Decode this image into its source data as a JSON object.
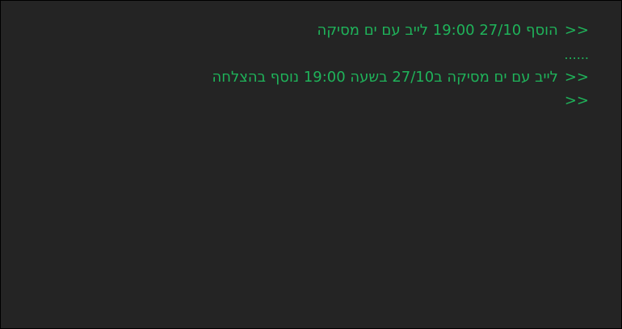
{
  "terminal": {
    "prompt": ">>",
    "lines": [
      {
        "type": "input",
        "text": "הוסף 27/10 19:00 לייב עם ים מסיקה"
      },
      {
        "type": "output",
        "text": "......"
      },
      {
        "type": "output_prompted",
        "text": "לייב עם ים מסיקה ב27/10 בשעה 19:00 נוסף בהצלחה"
      },
      {
        "type": "input",
        "text": ""
      }
    ]
  },
  "colors": {
    "background": "#242424",
    "text": "#1fb35a"
  }
}
